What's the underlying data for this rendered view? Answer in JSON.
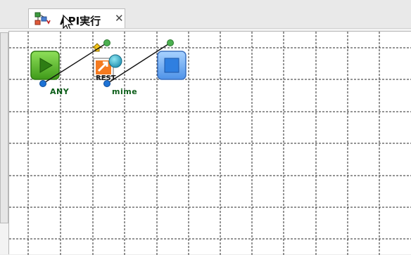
{
  "editor": {
    "tab": {
      "title": "API実行",
      "close_glyph": "✕",
      "icon": "flow-diagram-icon"
    }
  },
  "canvas": {
    "grid": "dashed",
    "nodes": [
      {
        "id": "start",
        "icon": "play-icon"
      },
      {
        "id": "rest",
        "icon": "rest-api-icon",
        "icon_text": "REST"
      },
      {
        "id": "end",
        "icon": "stop-icon"
      }
    ],
    "ports": {
      "any_label": "ANY",
      "mime_label": "mime"
    }
  },
  "colors": {
    "start_green": "#5cc02a",
    "stop_blue": "#2f7fe0",
    "port_blue": "#1e73d6",
    "port_green": "#4caf50",
    "label_green": "#0b5d18"
  }
}
